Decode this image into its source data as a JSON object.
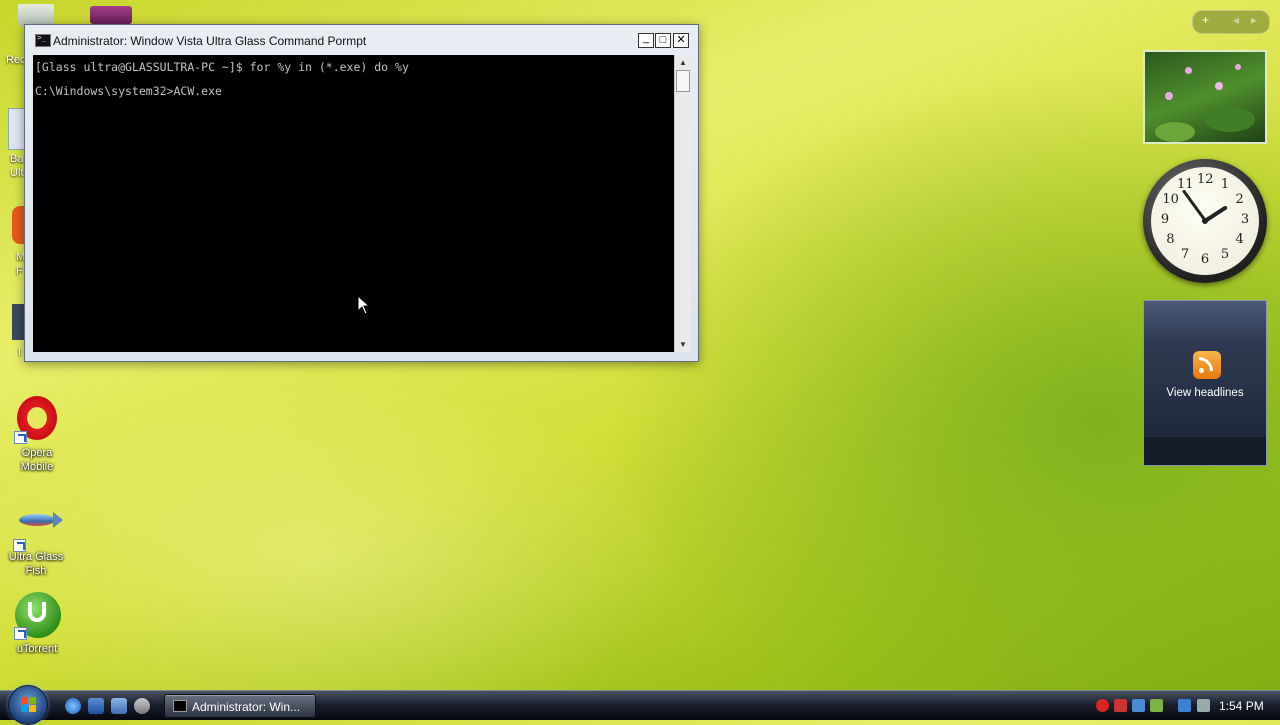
{
  "desktop": {
    "icons": [
      {
        "label": "Opera\nMobile"
      },
      {
        "label": "Ultra Glass\nFish"
      },
      {
        "label": "uTorrent"
      }
    ],
    "partial_labels": [
      "Rec",
      "Ba\nUlt",
      "M\nF",
      "I"
    ]
  },
  "window": {
    "title": "Administrator:  Window Vista Ultra Glass Command Pormpt",
    "console_lines": [
      "[Glass ultra@GLASSULTRA-PC ~]$ for %y in (*.exe) do %y",
      "C:\\Windows\\system32>ACW.exe"
    ],
    "minimize_label": "_",
    "maximize_label": "□",
    "close_label": "✕"
  },
  "sidebar": {
    "add_label": "+",
    "prev_label": "◂",
    "next_label": "▸",
    "clock_numbers": [
      "12",
      "1",
      "2",
      "3",
      "4",
      "5",
      "6",
      "7",
      "8",
      "9",
      "10",
      "11"
    ],
    "clock_time": {
      "hour": 1,
      "minute": 54
    },
    "feed_text": "View headlines"
  },
  "taskbar": {
    "task_label": "Administrator:  Win...",
    "time": "1:54 PM"
  },
  "colors": {
    "flag_red": "#f25022",
    "flag_green": "#7fba00",
    "flag_blue": "#00a4ef",
    "flag_yellow": "#ffb900"
  }
}
